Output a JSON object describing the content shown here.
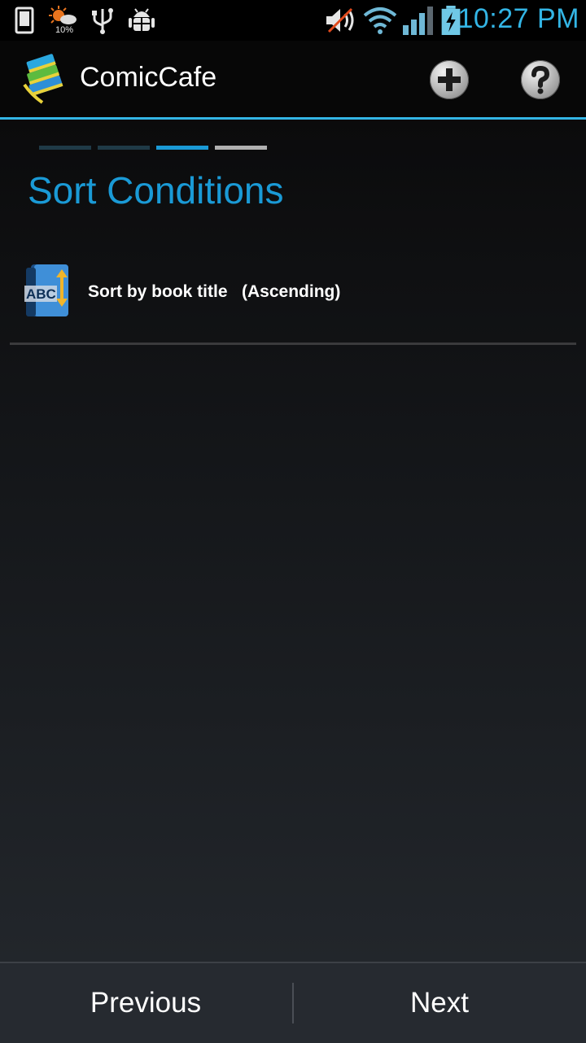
{
  "status_bar": {
    "time": "10:27 PM",
    "weather_badge": "10%",
    "icons": [
      "phone-icon",
      "weather-icon",
      "usb-icon",
      "android-debug-icon",
      "mute-icon",
      "wifi-icon",
      "signal-icon",
      "battery-charging-icon"
    ]
  },
  "action_bar": {
    "title": "ComicCafe",
    "add_icon": "plus-icon",
    "help_icon": "question-icon"
  },
  "wizard": {
    "steps": [
      {
        "state": "done",
        "color": "#1f3a47"
      },
      {
        "state": "done",
        "color": "#1f3a47"
      },
      {
        "state": "current",
        "color": "#1a9ad6"
      },
      {
        "state": "upcoming",
        "color": "#b0b0b0"
      }
    ],
    "section_title": "Sort Conditions"
  },
  "sort_conditions": [
    {
      "label": "Sort by book title   (Ascending)",
      "icon": "abc-sort-icon"
    }
  ],
  "buttons": {
    "previous": "Previous",
    "next": "Next"
  },
  "colors": {
    "accent": "#33b5e5",
    "title": "#1a9ad6"
  }
}
